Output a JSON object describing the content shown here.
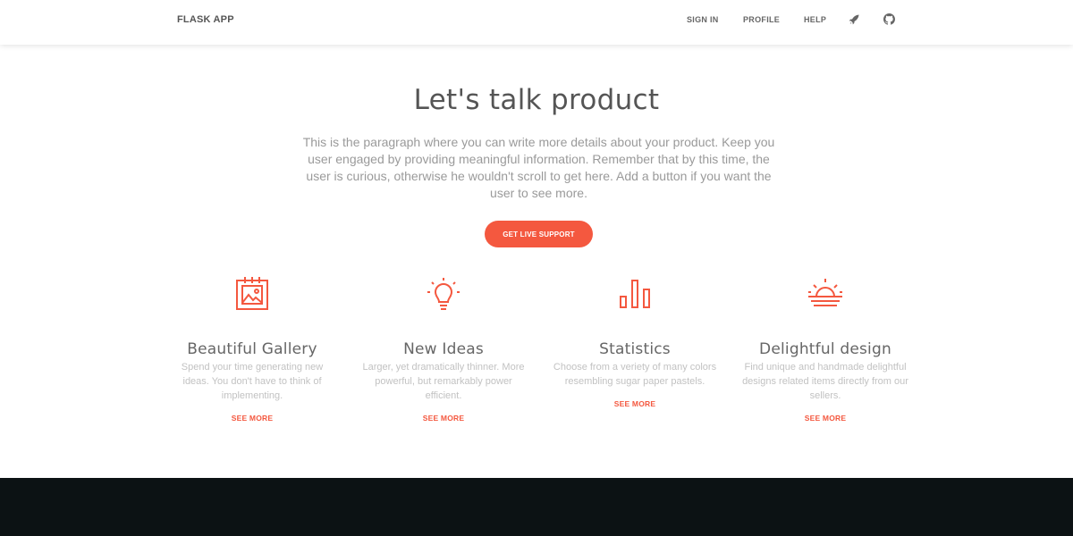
{
  "navbar": {
    "brand": "FLASK APP",
    "links": {
      "sign_in": "SIGN IN",
      "profile": "PROFILE",
      "help": "HELP"
    },
    "icons": [
      "rocket-icon",
      "github-icon"
    ]
  },
  "hero": {
    "title": "Let's talk product",
    "text": "This is the paragraph where you can write more details about your product. Keep you user engaged by providing meaningful information. Remember that by this time, the user is curious, otherwise he wouldn't scroll to get here. Add a button if you want the user to see more.",
    "cta_label": "GET LIVE SUPPORT"
  },
  "features": [
    {
      "icon": "gallery-icon",
      "title": "Beautiful Gallery",
      "text": "Spend your time generating new ideas. You don't have to think of implementing.",
      "link": "SEE MORE"
    },
    {
      "icon": "lightbulb-icon",
      "title": "New Ideas",
      "text": "Larger, yet dramatically thinner. More powerful, but remarkably power efficient.",
      "link": "SEE MORE"
    },
    {
      "icon": "bar-chart-icon",
      "title": "Statistics",
      "text": "Choose from a veriety of many colors resembling sugar paper pastels.",
      "link": "SEE MORE"
    },
    {
      "icon": "sunrise-icon",
      "title": "Delightful design",
      "text": "Find unique and handmade delightful designs related items directly from our sellers.",
      "link": "SEE MORE"
    }
  ],
  "colors": {
    "accent": "#f4583f",
    "footer_bg": "#0c1214",
    "nav_text": "#666666",
    "muted_text": "#9a9a9a"
  }
}
